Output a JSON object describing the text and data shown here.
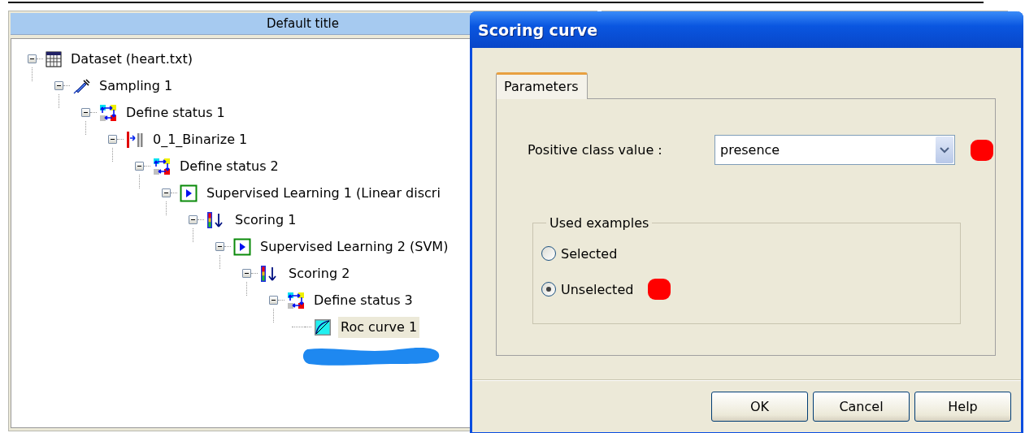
{
  "tree_window": {
    "title": "Default title"
  },
  "tree": [
    {
      "label": "Dataset (heart.txt)",
      "kind": "dataset",
      "expanded": true,
      "selected": false,
      "children": [
        {
          "label": "Sampling 1",
          "kind": "sampling",
          "expanded": true,
          "selected": false,
          "children": [
            {
              "label": "Define status 1",
              "kind": "status",
              "expanded": true,
              "selected": false,
              "children": [
                {
                  "label": "0_1_Binarize 1",
                  "kind": "binarize",
                  "expanded": true,
                  "selected": false,
                  "children": [
                    {
                      "label": "Define status 2",
                      "kind": "status",
                      "expanded": true,
                      "selected": false,
                      "children": [
                        {
                          "label": "Supervised Learning 1 (Linear discri",
                          "kind": "learning",
                          "expanded": true,
                          "selected": false,
                          "children": [
                            {
                              "label": "Scoring 1",
                              "kind": "scoring",
                              "expanded": true,
                              "selected": false,
                              "children": [
                                {
                                  "label": "Supervised Learning 2 (SVM)",
                                  "kind": "learning",
                                  "expanded": true,
                                  "selected": false,
                                  "children": [
                                    {
                                      "label": "Scoring 2",
                                      "kind": "scoring",
                                      "expanded": true,
                                      "selected": false,
                                      "children": [
                                        {
                                          "label": "Define status 3",
                                          "kind": "status",
                                          "expanded": true,
                                          "selected": false,
                                          "children": [
                                            {
                                              "label": "Roc curve 1",
                                              "kind": "roc",
                                              "selected": true
                                            }
                                          ]
                                        }
                                      ]
                                    }
                                  ]
                                }
                              ]
                            }
                          ]
                        }
                      ]
                    }
                  ]
                }
              ]
            }
          ]
        }
      ]
    }
  ],
  "dialog": {
    "title": "Scoring curve",
    "tabs": [
      {
        "label": "Parameters",
        "selected": true
      }
    ],
    "positive_class": {
      "label": "Positive class value :",
      "value": "presence"
    },
    "used_examples": {
      "legend": "Used examples",
      "options": [
        {
          "label": "Selected",
          "selected": false
        },
        {
          "label": "Unselected",
          "selected": true
        }
      ]
    },
    "buttons": [
      "OK",
      "Cancel",
      "Help"
    ]
  }
}
